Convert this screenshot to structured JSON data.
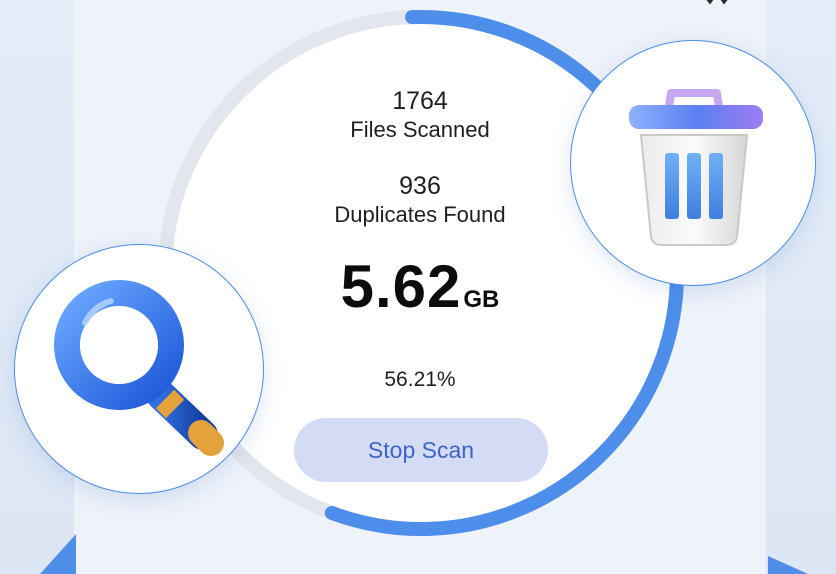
{
  "stats": {
    "files_scanned_count": "1764",
    "files_scanned_label": "Files Scanned",
    "duplicates_count": "936",
    "duplicates_label": "Duplicates Found",
    "size_value": "5.62",
    "size_unit": "GB",
    "progress_percent": "56.21%"
  },
  "progress": {
    "fraction": 0.5621
  },
  "actions": {
    "stop_label": "Stop Scan"
  },
  "icons": {
    "search": "magnifier-icon",
    "trash": "trash-bin-icon",
    "top_right": "crown-icon"
  },
  "colors": {
    "accent": "#4c8ee9",
    "track": "#e3e6ec",
    "button_bg": "#d4dbf4",
    "button_text": "#3d64c8"
  }
}
